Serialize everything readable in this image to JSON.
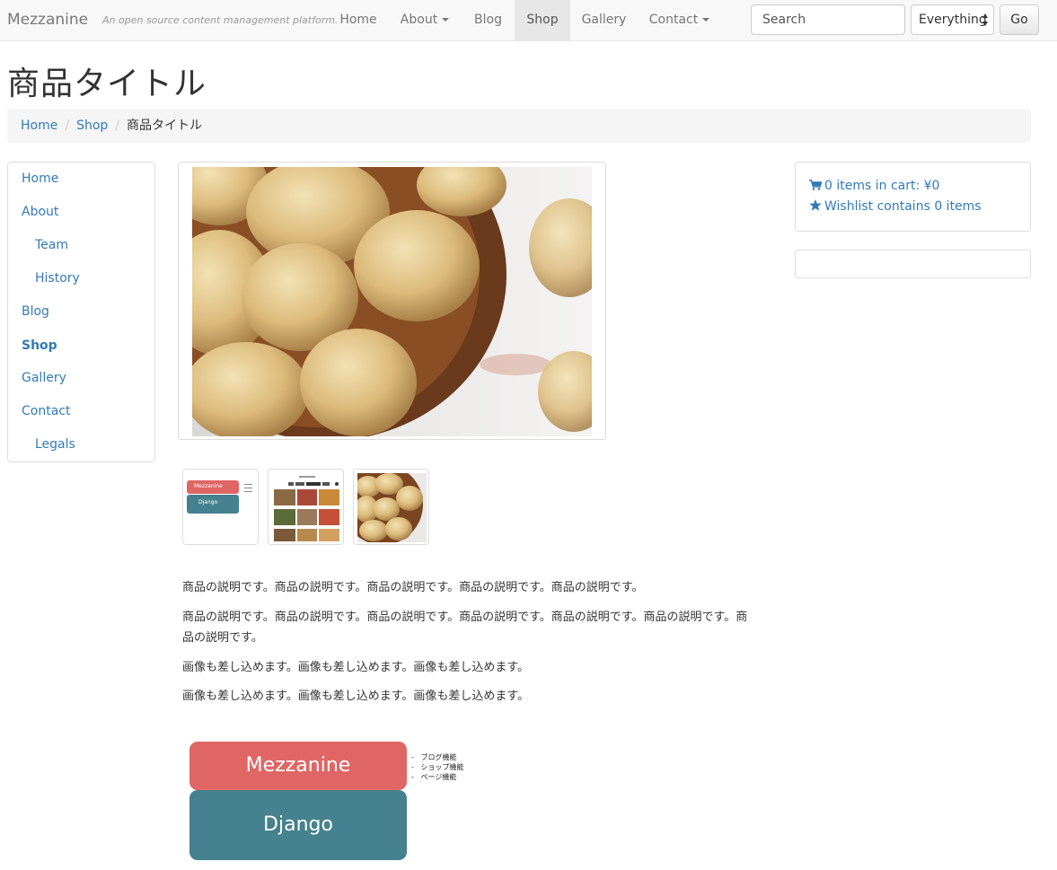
{
  "navbar": {
    "brand": "Mezzanine",
    "tagline": "An open source content management platform.",
    "items": [
      {
        "label": "Home"
      },
      {
        "label": "About"
      },
      {
        "label": "Blog"
      },
      {
        "label": "Shop"
      },
      {
        "label": "Gallery"
      },
      {
        "label": "Contact"
      }
    ],
    "search_placeholder": "Search",
    "search_scope": "Everything",
    "go_label": "Go"
  },
  "page_title": "商品タイトル",
  "breadcrumb": [
    "Home",
    "Shop",
    "商品タイトル"
  ],
  "sidebar": {
    "items": [
      {
        "label": "Home"
      },
      {
        "label": "About"
      },
      {
        "label": "Team"
      },
      {
        "label": "History"
      },
      {
        "label": "Blog"
      },
      {
        "label": "Shop"
      },
      {
        "label": "Gallery"
      },
      {
        "label": "Contact"
      },
      {
        "label": "Legals"
      }
    ]
  },
  "product": {
    "description": [
      "商品の説明です。商品の説明です。商品の説明です。商品の説明です。商品の説明です。",
      "商品の説明です。商品の説明です。商品の説明です。商品の説明です。商品の説明です。商品の説明です。商品の説明です。",
      "画像も差し込めます。画像も差し込めます。画像も差し込めます。",
      "画像も差し込めます。画像も差し込めます。画像も差し込めます。"
    ],
    "diagram": {
      "top": "Mezzanine",
      "bottom": "Django",
      "bullets": [
        "ブログ機能",
        "ショップ機能",
        "ページ機能"
      ]
    },
    "thumb_diagram": {
      "top": "Mezzanine",
      "bottom": "Django"
    }
  },
  "cart": {
    "cart_text": "0 items in cart: ¥0",
    "wishlist_text": "Wishlist contains 0 items"
  },
  "colors": {
    "link": "#337ab7",
    "mezzanine_box": "#e06666",
    "django_box": "#45818e"
  }
}
